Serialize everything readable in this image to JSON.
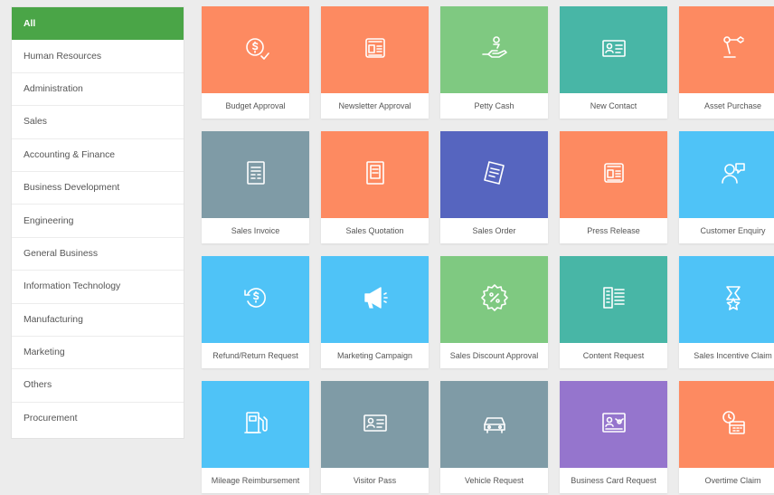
{
  "sidebar": {
    "items": [
      {
        "label": "All",
        "active": true
      },
      {
        "label": "Human Resources"
      },
      {
        "label": "Administration"
      },
      {
        "label": "Sales"
      },
      {
        "label": "Accounting & Finance"
      },
      {
        "label": "Business Development"
      },
      {
        "label": "Engineering"
      },
      {
        "label": "General Business"
      },
      {
        "label": "Information Technology"
      },
      {
        "label": "Manufacturing"
      },
      {
        "label": "Marketing"
      },
      {
        "label": "Others"
      },
      {
        "label": "Procurement"
      }
    ]
  },
  "colors": {
    "active": "#4aa547",
    "orange": "#fd8a61",
    "green": "#7fc981",
    "teal": "#48b6a6",
    "slate": "#7f9ba6",
    "indigo": "#5665bf",
    "sky": "#4fc3f7",
    "purple": "#9575cd"
  },
  "templates": [
    {
      "label": "Budget Approval",
      "color": "#fd8a61",
      "icon": "dollar-check-icon"
    },
    {
      "label": "Newsletter Approval",
      "color": "#fd8a61",
      "icon": "newspaper-icon"
    },
    {
      "label": "Petty Cash",
      "color": "#7fc981",
      "icon": "hand-coin-icon"
    },
    {
      "label": "New Contact",
      "color": "#48b6a6",
      "icon": "contact-card-icon"
    },
    {
      "label": "Asset Purchase",
      "color": "#fd8a61",
      "icon": "robot-arm-icon"
    },
    {
      "label": "Sales Invoice",
      "color": "#7f9ba6",
      "icon": "invoice-icon"
    },
    {
      "label": "Sales Quotation",
      "color": "#fd8a61",
      "icon": "quotation-icon"
    },
    {
      "label": "Sales Order",
      "color": "#5665bf",
      "icon": "order-receipt-icon"
    },
    {
      "label": "Press Release",
      "color": "#fd8a61",
      "icon": "newspaper-icon"
    },
    {
      "label": "Customer Enquiry",
      "color": "#4fc3f7",
      "icon": "person-chat-icon"
    },
    {
      "label": "Refund/Return Request",
      "color": "#4fc3f7",
      "icon": "refund-icon"
    },
    {
      "label": "Marketing Campaign",
      "color": "#4fc3f7",
      "icon": "megaphone-icon"
    },
    {
      "label": "Sales Discount Approval",
      "color": "#7fc981",
      "icon": "percent-badge-icon"
    },
    {
      "label": "Content Request",
      "color": "#48b6a6",
      "icon": "content-list-icon"
    },
    {
      "label": "Sales Incentive Claim",
      "color": "#4fc3f7",
      "icon": "trophy-star-icon"
    },
    {
      "label": "Mileage Reimbursement",
      "color": "#4fc3f7",
      "icon": "fuel-pump-icon"
    },
    {
      "label": "Visitor Pass",
      "color": "#7f9ba6",
      "icon": "contact-card-icon"
    },
    {
      "label": "Vehicle Request",
      "color": "#7f9ba6",
      "icon": "car-icon"
    },
    {
      "label": "Business Card Request",
      "color": "#9575cd",
      "icon": "business-card-icon"
    },
    {
      "label": "Overtime Claim",
      "color": "#fd8a61",
      "icon": "clock-calendar-icon"
    }
  ]
}
